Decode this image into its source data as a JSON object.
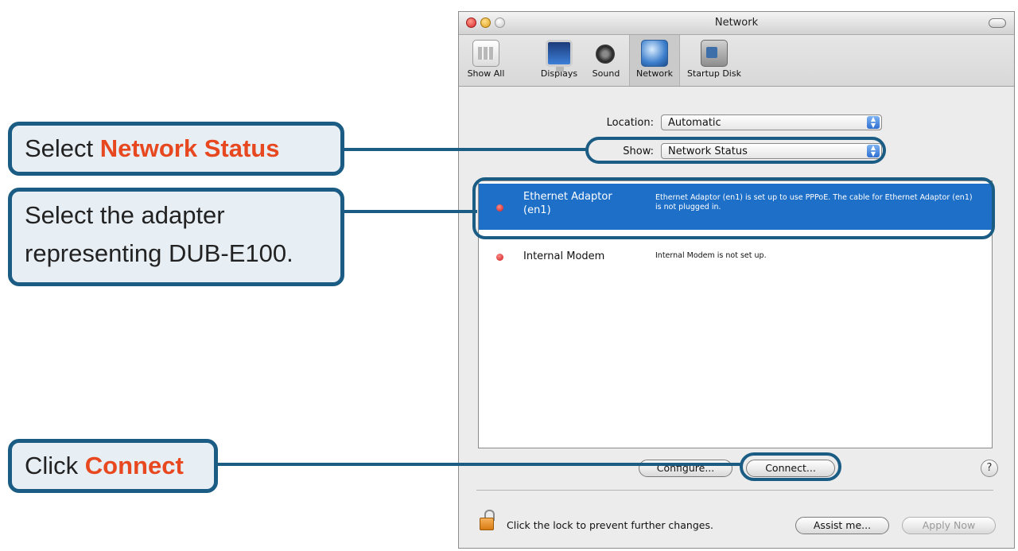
{
  "window": {
    "title": "Network",
    "toolbar": [
      {
        "label": "Show All",
        "icon": "show-all-icon"
      },
      {
        "label": "Displays",
        "icon": "display-icon"
      },
      {
        "label": "Sound",
        "icon": "speaker-icon"
      },
      {
        "label": "Network",
        "icon": "network-globe-icon",
        "selected": true
      },
      {
        "label": "Startup Disk",
        "icon": "hard-disk-icon"
      }
    ],
    "location_label": "Location:",
    "location_value": "Automatic",
    "show_label": "Show:",
    "show_value": "Network Status",
    "adapters": [
      {
        "name": "Ethernet Adaptor (en1)",
        "status": "Ethernet Adaptor (en1) is set up to use PPPoE. The cable for Ethernet Adaptor (en1) is not plugged in.",
        "selected": true
      },
      {
        "name": "Internal Modem",
        "status": "Internal Modem is not set up.",
        "selected": false
      }
    ],
    "configure_button": "Configure...",
    "connect_button": "Connect...",
    "help_button": "?",
    "lock_text": "Click the lock to prevent further changes.",
    "assist_button": "Assist me...",
    "apply_button": "Apply Now"
  },
  "callouts": {
    "status": {
      "prefix": "Select ",
      "highlight": "Network Status"
    },
    "adapter": {
      "line1": "Select the adapter",
      "line2": "representing DUB-E100."
    },
    "connect": {
      "prefix": "Click ",
      "highlight": "Connect"
    }
  },
  "colors": {
    "callout_border": "#1b5c84",
    "callout_fill": "#e7eef4",
    "highlight": "#e8481f",
    "selection": "#1e6fc8"
  }
}
